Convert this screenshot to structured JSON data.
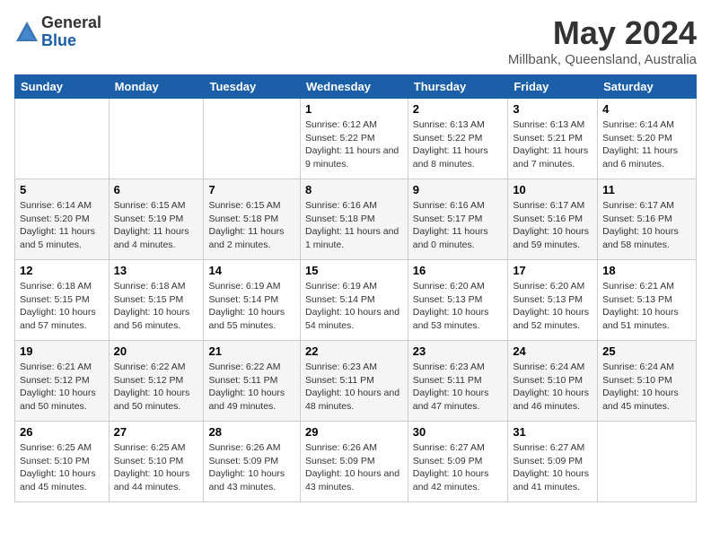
{
  "logo": {
    "general": "General",
    "blue": "Blue"
  },
  "title": "May 2024",
  "subtitle": "Millbank, Queensland, Australia",
  "days_of_week": [
    "Sunday",
    "Monday",
    "Tuesday",
    "Wednesday",
    "Thursday",
    "Friday",
    "Saturday"
  ],
  "weeks": [
    [
      {
        "day": "",
        "info": ""
      },
      {
        "day": "",
        "info": ""
      },
      {
        "day": "",
        "info": ""
      },
      {
        "day": "1",
        "info": "Sunrise: 6:12 AM\nSunset: 5:22 PM\nDaylight: 11 hours and 9 minutes."
      },
      {
        "day": "2",
        "info": "Sunrise: 6:13 AM\nSunset: 5:22 PM\nDaylight: 11 hours and 8 minutes."
      },
      {
        "day": "3",
        "info": "Sunrise: 6:13 AM\nSunset: 5:21 PM\nDaylight: 11 hours and 7 minutes."
      },
      {
        "day": "4",
        "info": "Sunrise: 6:14 AM\nSunset: 5:20 PM\nDaylight: 11 hours and 6 minutes."
      }
    ],
    [
      {
        "day": "5",
        "info": "Sunrise: 6:14 AM\nSunset: 5:20 PM\nDaylight: 11 hours and 5 minutes."
      },
      {
        "day": "6",
        "info": "Sunrise: 6:15 AM\nSunset: 5:19 PM\nDaylight: 11 hours and 4 minutes."
      },
      {
        "day": "7",
        "info": "Sunrise: 6:15 AM\nSunset: 5:18 PM\nDaylight: 11 hours and 2 minutes."
      },
      {
        "day": "8",
        "info": "Sunrise: 6:16 AM\nSunset: 5:18 PM\nDaylight: 11 hours and 1 minute."
      },
      {
        "day": "9",
        "info": "Sunrise: 6:16 AM\nSunset: 5:17 PM\nDaylight: 11 hours and 0 minutes."
      },
      {
        "day": "10",
        "info": "Sunrise: 6:17 AM\nSunset: 5:16 PM\nDaylight: 10 hours and 59 minutes."
      },
      {
        "day": "11",
        "info": "Sunrise: 6:17 AM\nSunset: 5:16 PM\nDaylight: 10 hours and 58 minutes."
      }
    ],
    [
      {
        "day": "12",
        "info": "Sunrise: 6:18 AM\nSunset: 5:15 PM\nDaylight: 10 hours and 57 minutes."
      },
      {
        "day": "13",
        "info": "Sunrise: 6:18 AM\nSunset: 5:15 PM\nDaylight: 10 hours and 56 minutes."
      },
      {
        "day": "14",
        "info": "Sunrise: 6:19 AM\nSunset: 5:14 PM\nDaylight: 10 hours and 55 minutes."
      },
      {
        "day": "15",
        "info": "Sunrise: 6:19 AM\nSunset: 5:14 PM\nDaylight: 10 hours and 54 minutes."
      },
      {
        "day": "16",
        "info": "Sunrise: 6:20 AM\nSunset: 5:13 PM\nDaylight: 10 hours and 53 minutes."
      },
      {
        "day": "17",
        "info": "Sunrise: 6:20 AM\nSunset: 5:13 PM\nDaylight: 10 hours and 52 minutes."
      },
      {
        "day": "18",
        "info": "Sunrise: 6:21 AM\nSunset: 5:13 PM\nDaylight: 10 hours and 51 minutes."
      }
    ],
    [
      {
        "day": "19",
        "info": "Sunrise: 6:21 AM\nSunset: 5:12 PM\nDaylight: 10 hours and 50 minutes."
      },
      {
        "day": "20",
        "info": "Sunrise: 6:22 AM\nSunset: 5:12 PM\nDaylight: 10 hours and 50 minutes."
      },
      {
        "day": "21",
        "info": "Sunrise: 6:22 AM\nSunset: 5:11 PM\nDaylight: 10 hours and 49 minutes."
      },
      {
        "day": "22",
        "info": "Sunrise: 6:23 AM\nSunset: 5:11 PM\nDaylight: 10 hours and 48 minutes."
      },
      {
        "day": "23",
        "info": "Sunrise: 6:23 AM\nSunset: 5:11 PM\nDaylight: 10 hours and 47 minutes."
      },
      {
        "day": "24",
        "info": "Sunrise: 6:24 AM\nSunset: 5:10 PM\nDaylight: 10 hours and 46 minutes."
      },
      {
        "day": "25",
        "info": "Sunrise: 6:24 AM\nSunset: 5:10 PM\nDaylight: 10 hours and 45 minutes."
      }
    ],
    [
      {
        "day": "26",
        "info": "Sunrise: 6:25 AM\nSunset: 5:10 PM\nDaylight: 10 hours and 45 minutes."
      },
      {
        "day": "27",
        "info": "Sunrise: 6:25 AM\nSunset: 5:10 PM\nDaylight: 10 hours and 44 minutes."
      },
      {
        "day": "28",
        "info": "Sunrise: 6:26 AM\nSunset: 5:09 PM\nDaylight: 10 hours and 43 minutes."
      },
      {
        "day": "29",
        "info": "Sunrise: 6:26 AM\nSunset: 5:09 PM\nDaylight: 10 hours and 43 minutes."
      },
      {
        "day": "30",
        "info": "Sunrise: 6:27 AM\nSunset: 5:09 PM\nDaylight: 10 hours and 42 minutes."
      },
      {
        "day": "31",
        "info": "Sunrise: 6:27 AM\nSunset: 5:09 PM\nDaylight: 10 hours and 41 minutes."
      },
      {
        "day": "",
        "info": ""
      }
    ]
  ]
}
